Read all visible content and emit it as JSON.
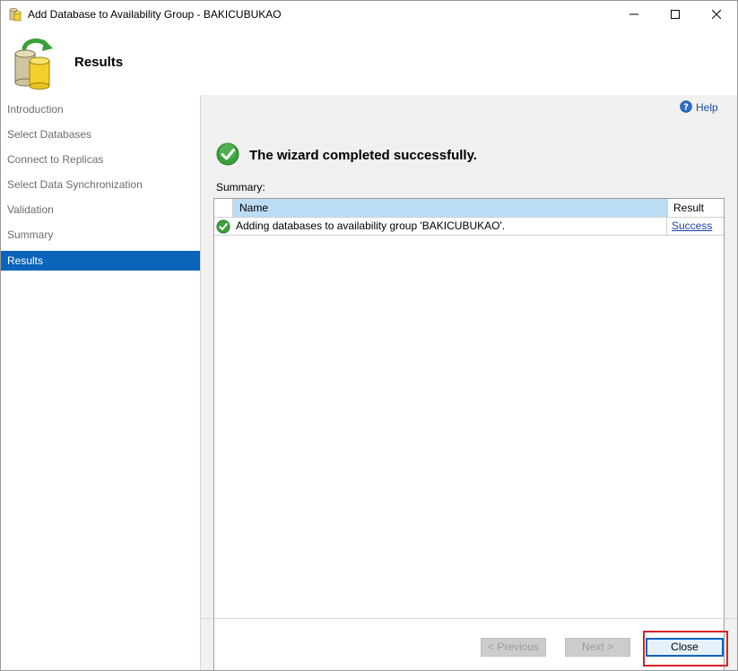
{
  "window": {
    "title": "Add Database to Availability Group - BAKICUBUKAO"
  },
  "header": {
    "title": "Results"
  },
  "sidebar": {
    "items": [
      {
        "label": "Introduction",
        "active": false
      },
      {
        "label": "Select Databases",
        "active": false
      },
      {
        "label": "Connect to Replicas",
        "active": false
      },
      {
        "label": "Select Data Synchronization",
        "active": false
      },
      {
        "label": "Validation",
        "active": false
      },
      {
        "label": "Summary",
        "active": false
      },
      {
        "label": "Results",
        "active": true
      }
    ]
  },
  "content": {
    "help_label": "Help",
    "success_message": "The wizard completed successfully.",
    "summary_label": "Summary:",
    "table": {
      "columns": [
        "Name",
        "Result"
      ],
      "rows": [
        {
          "status_icon": "success-check-icon",
          "name": "Adding databases to availability group 'BAKICUBUKAO'.",
          "result": "Success"
        }
      ]
    }
  },
  "footer": {
    "previous_label": "< Previous",
    "next_label": "Next >",
    "close_label": "Close"
  },
  "colors": {
    "accent": "#0a64ba",
    "header_column": "#bcdcf4",
    "success_green": "#3aa03a",
    "highlight_red": "#d92128"
  }
}
